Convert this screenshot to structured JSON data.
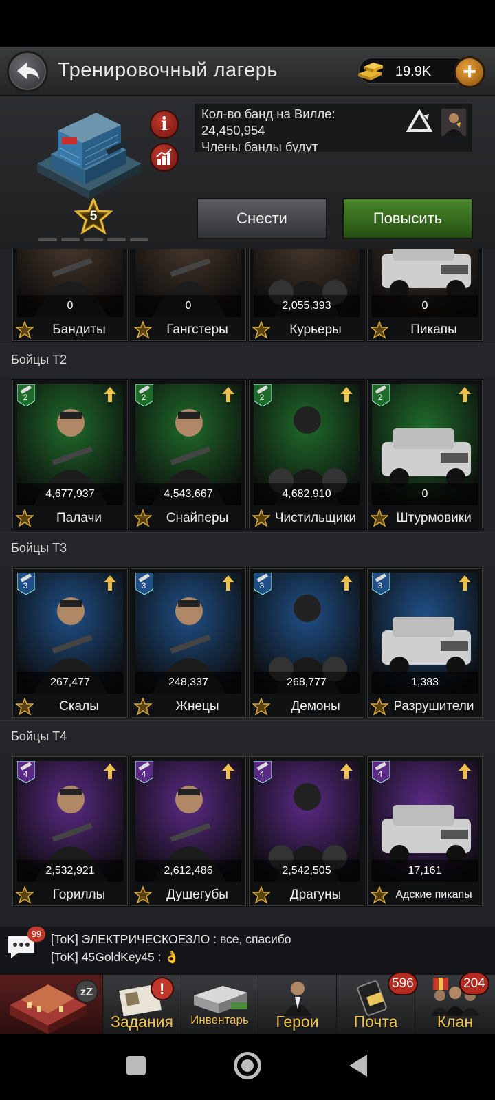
{
  "header": {
    "title": "Тренировочный лагерь",
    "gold": "19.9K",
    "back_icon": "back-arrow-icon",
    "plus_icon": "plus-icon"
  },
  "building": {
    "level": "5",
    "info_lines": [
      "Кол-во банд на Вилле:",
      "24,450,954",
      "Члены банды будут"
    ],
    "destroy_label": "Снести",
    "upgrade_label": "Повысить",
    "info_icon": "info-icon",
    "stats_icon": "chart-icon"
  },
  "tiers": [
    {
      "label": "",
      "units": [
        {
          "name": "Бандиты",
          "count": "0"
        },
        {
          "name": "Гангстеры",
          "count": "0"
        },
        {
          "name": "Курьеры",
          "count": "2,055,393"
        },
        {
          "name": "Пикапы",
          "count": "0"
        }
      ]
    },
    {
      "label": "Бойцы Т2",
      "tier": "2",
      "color": "#1f6b2a",
      "units": [
        {
          "name": "Палачи",
          "count": "4,677,937"
        },
        {
          "name": "Снайперы",
          "count": "4,543,667"
        },
        {
          "name": "Чистильщики",
          "count": "4,682,910"
        },
        {
          "name": "Штурмовики",
          "count": "0"
        }
      ]
    },
    {
      "label": "Бойцы Т3",
      "tier": "3",
      "color": "#1f4f86",
      "units": [
        {
          "name": "Скалы",
          "count": "267,477"
        },
        {
          "name": "Жнецы",
          "count": "248,337"
        },
        {
          "name": "Демоны",
          "count": "268,777"
        },
        {
          "name": "Разрушители",
          "count": "1,383"
        }
      ]
    },
    {
      "label": "Бойцы Т4",
      "tier": "4",
      "color": "#5b2a86",
      "units": [
        {
          "name": "Гориллы",
          "count": "2,532,921"
        },
        {
          "name": "Душегубы",
          "count": "2,612,486"
        },
        {
          "name": "Драгуны",
          "count": "2,542,505"
        },
        {
          "name": "Адские пикапы",
          "count": "17,161"
        }
      ]
    }
  ],
  "chat": {
    "badge": "99",
    "lines": [
      "[ToK] ЭЛЕКТРИЧЕСКОЕЗЛО : все, спасибо",
      "[ToK] 45GoldKey45 : 👌"
    ]
  },
  "nav": [
    {
      "label": "",
      "badge": "",
      "icon": "base-icon"
    },
    {
      "label": "Задания",
      "badge": "",
      "icon": "tasks-icon"
    },
    {
      "label": "Инвентарь",
      "badge": "",
      "icon": "inventory-icon"
    },
    {
      "label": "Герои",
      "badge": "",
      "icon": "heroes-icon"
    },
    {
      "label": "Почта",
      "badge": "596",
      "icon": "mail-icon"
    },
    {
      "label": "Клан",
      "badge": "204",
      "icon": "clan-icon"
    }
  ],
  "colors": {
    "gold": "#f0c24c",
    "upgrade_green": "#3f7d22",
    "badge_red": "#b52b20"
  }
}
